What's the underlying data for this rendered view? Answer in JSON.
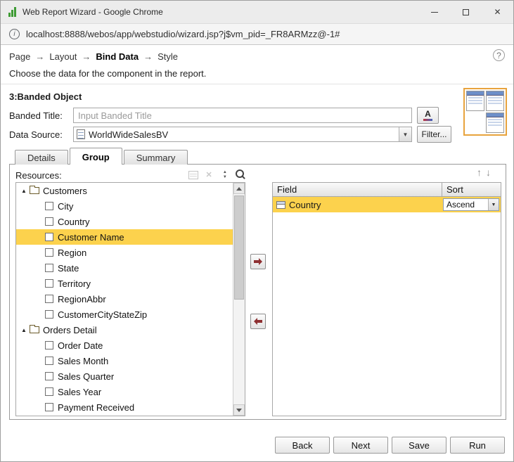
{
  "window": {
    "title": "Web Report Wizard - Google Chrome",
    "url": "localhost:8888/webos/app/webstudio/wizard.jsp?j$vm_pid=_FR8ARMzz@-1#"
  },
  "breadcrumb": {
    "items": [
      "Page",
      "Layout",
      "Bind Data",
      "Style"
    ],
    "active": "Bind Data",
    "separator": "→"
  },
  "description": "Choose the data for the component in the report.",
  "section": {
    "title": "3:Banded Object",
    "banded_title_label": "Banded Title:",
    "banded_title_placeholder": "Input Banded Title",
    "font_button": "A",
    "data_source_label": "Data Source:",
    "data_source_value": "WorldWideSalesBV",
    "filter_button": "Filter..."
  },
  "tabs": [
    {
      "label": "Details",
      "active": false
    },
    {
      "label": "Group",
      "active": true
    },
    {
      "label": "Summary",
      "active": false
    }
  ],
  "resources": {
    "label": "Resources:",
    "tree": [
      {
        "type": "folder",
        "label": "Customers",
        "expanded": true
      },
      {
        "type": "item",
        "label": "City"
      },
      {
        "type": "item",
        "label": "Country"
      },
      {
        "type": "item",
        "label": "Customer Name",
        "selected": true
      },
      {
        "type": "item",
        "label": "Region"
      },
      {
        "type": "item",
        "label": "State"
      },
      {
        "type": "item",
        "label": "Territory"
      },
      {
        "type": "item",
        "label": "RegionAbbr"
      },
      {
        "type": "item",
        "label": "CustomerCityStateZip"
      },
      {
        "type": "folder",
        "label": "Orders Detail",
        "expanded": true
      },
      {
        "type": "item",
        "label": "Order Date"
      },
      {
        "type": "item",
        "label": "Sales Month"
      },
      {
        "type": "item",
        "label": "Sales Quarter"
      },
      {
        "type": "item",
        "label": "Sales Year"
      },
      {
        "type": "item",
        "label": "Payment Received"
      }
    ]
  },
  "group_table": {
    "columns": [
      "Field",
      "Sort"
    ],
    "rows": [
      {
        "field": "Country",
        "sort": "Ascend",
        "selected": true
      }
    ]
  },
  "footer_buttons": [
    "Back",
    "Next",
    "Save",
    "Run"
  ],
  "icons": {
    "info": "i",
    "help": "?",
    "close": "✕",
    "remove": "✕",
    "dropdown_arrow": "▼",
    "tree_expanded": "▲",
    "move_up": "↑",
    "move_down": "↓"
  },
  "colors": {
    "selection": "#fcd24d",
    "transfer_arrow": "#8e3032",
    "logo_green": "#3f9c35",
    "preview_border": "#e8a33d",
    "preview_header_blue": "#6d8fc9"
  }
}
